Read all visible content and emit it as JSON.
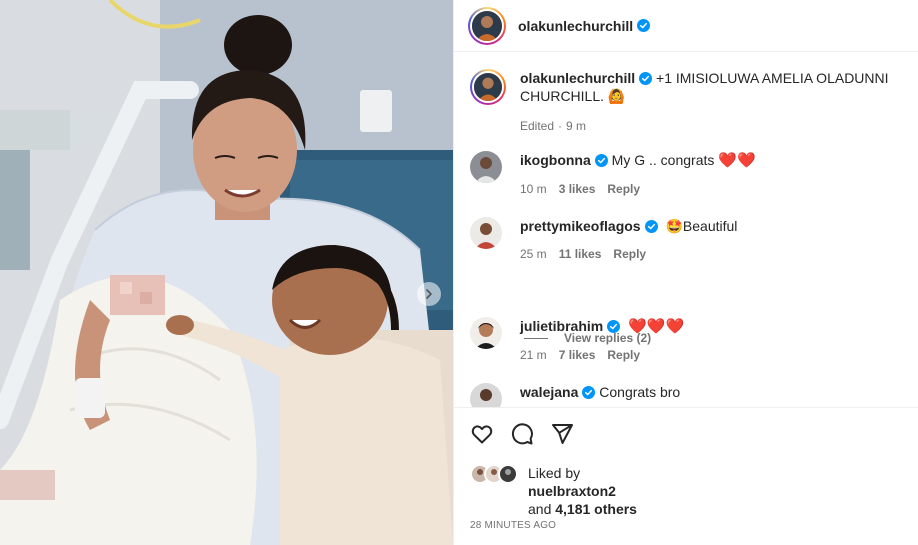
{
  "post": {
    "author": "olakunlechurchill",
    "author_avatar_icon": "profile-photo",
    "caption": "+1 IMISIOLUWA AMELIA OLADUNNI CHURCHILL. 🙆",
    "edited": "Edited",
    "edited_sep": "·",
    "edited_time": "9 m"
  },
  "comments": [
    {
      "user": "ikogbonna",
      "text": "My G .. congrats",
      "emoji": "❤️❤️",
      "time": "10 m",
      "likes": "3 likes",
      "reply": "Reply"
    },
    {
      "user": "prettymikeoflagos",
      "emoji": "🤩",
      "text": "Beautiful",
      "time": "25 m",
      "likes": "11 likes",
      "reply": "Reply"
    },
    {
      "user": "julietibrahim",
      "text": "",
      "emoji": "❤️❤️❤️",
      "time": "21 m",
      "likes": "7 likes",
      "reply": "Reply"
    },
    {
      "user": "walejana",
      "text": "Congrats bro"
    }
  ],
  "view_replies": "View replies (2)",
  "likes": {
    "liked_by_label": "Liked by",
    "liked_by_user": "nuelbraxton2",
    "and_label": "and",
    "others": "4,181 others"
  },
  "timestamp": "28 MINUTES AGO",
  "icons": [
    "heart-icon",
    "comment-icon",
    "share-icon",
    "verified-badge-icon",
    "carousel-next-icon"
  ],
  "colors": {
    "verified": "#0095f6",
    "text": "#262626",
    "muted": "#737373",
    "heart": "#e0182d"
  }
}
